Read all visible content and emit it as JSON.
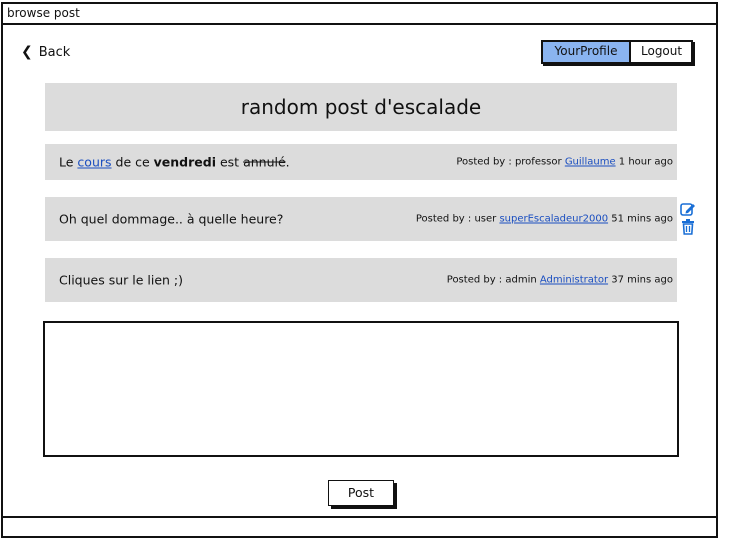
{
  "window": {
    "title": "browse post"
  },
  "nav": {
    "back_label": "Back"
  },
  "header": {
    "profile_label": "YourProfile",
    "logout_label": "Logout"
  },
  "topic": {
    "title": "random post d'escalade"
  },
  "posts": [
    {
      "message_parts": {
        "prefix": "Le ",
        "link": "cours",
        "middle": " de ce ",
        "bold": "vendredi",
        "after_bold": " est ",
        "strike": "annulé",
        "suffix": "."
      },
      "meta_prefix": "Posted by : professor",
      "author": "Guillaume",
      "time": "1 hour ago"
    },
    {
      "message": "Oh quel dommage.. à quelle heure?",
      "meta_prefix": "Posted by : user",
      "author": "superEscaladeur2000",
      "time": "51 mins ago"
    },
    {
      "message": "Cliques sur le lien ;)",
      "meta_prefix": "Posted by : admin",
      "author": "Administrator",
      "time": "37 mins ago"
    }
  ],
  "post_actions": {
    "edit_icon": "edit-icon",
    "delete_icon": "trash-icon",
    "color": "#1a6fd6"
  },
  "composer": {
    "value": "",
    "placeholder": "",
    "post_label": "Post"
  },
  "colors": {
    "post_bg": "#dcdcdc",
    "profile_btn": "#8ab4f0",
    "link": "#1a4ec0"
  }
}
